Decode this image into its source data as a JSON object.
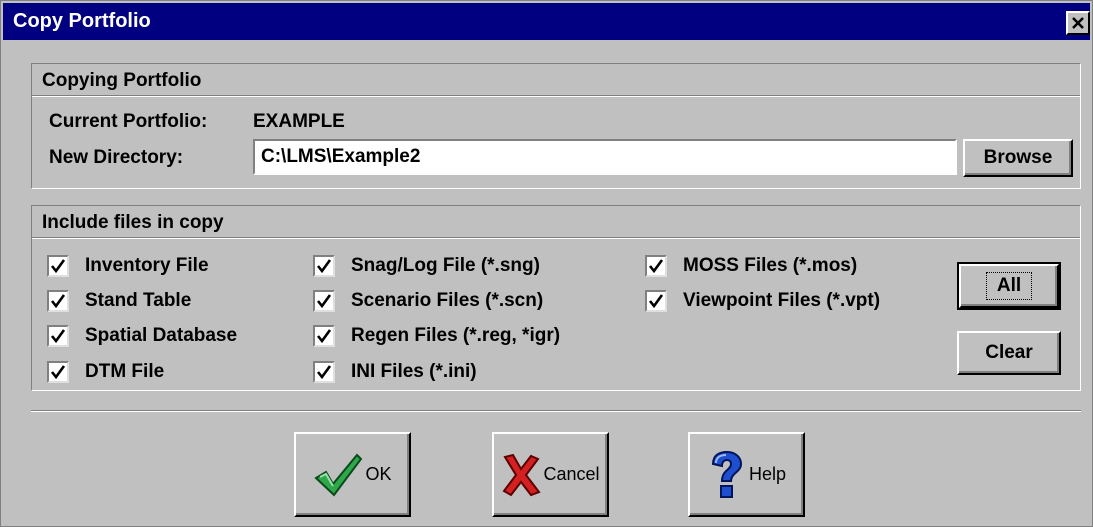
{
  "window": {
    "title": "Copy Portfolio"
  },
  "copying": {
    "header": "Copying Portfolio",
    "current_label": "Current Portfolio:",
    "current_value": "EXAMPLE",
    "new_dir_label": "New Directory:",
    "new_dir_value": "C:\\LMS\\Example2",
    "browse_label": "Browse"
  },
  "include": {
    "header": "Include files in copy",
    "items": [
      {
        "label": "Inventory File",
        "checked": true
      },
      {
        "label": "Stand Table",
        "checked": true
      },
      {
        "label": "Spatial Database",
        "checked": true
      },
      {
        "label": "DTM File",
        "checked": true
      },
      {
        "label": "Snag/Log File (*.sng)",
        "checked": true
      },
      {
        "label": "Scenario Files (*.scn)",
        "checked": true
      },
      {
        "label": "Regen Files (*.reg, *igr)",
        "checked": true
      },
      {
        "label": "INI Files (*.ini)",
        "checked": true
      },
      {
        "label": "MOSS Files (*.mos)",
        "checked": true
      },
      {
        "label": "Viewpoint Files (*.vpt)",
        "checked": true
      }
    ],
    "all_label": "All",
    "clear_label": "Clear"
  },
  "footer": {
    "ok_label": "OK",
    "cancel_label": "Cancel",
    "help_label": "Help"
  },
  "icons": {
    "close": "close-icon",
    "check": "checkmark-icon",
    "ok": "green-check-icon",
    "cancel": "red-x-icon",
    "help": "blue-question-icon"
  }
}
